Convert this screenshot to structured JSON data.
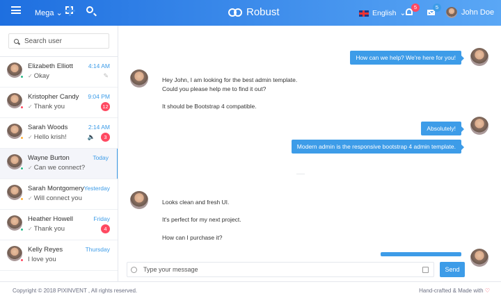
{
  "topbar": {
    "mega_label": "Mega",
    "brand": "Robust",
    "language": "English",
    "notifications_count": "5",
    "messages_count": "5",
    "user_name": "John Doe"
  },
  "sidebar": {
    "search_placeholder": "Search user",
    "contacts": [
      {
        "name": "Elizabeth Elliott",
        "time": "4:14 AM",
        "message": "Okay",
        "ticked": true,
        "badge": "",
        "pinned": true,
        "muted": false,
        "status": "#2bba8a",
        "active": false
      },
      {
        "name": "Kristopher Candy",
        "time": "9:04 PM",
        "message": "Thank you",
        "ticked": true,
        "badge": "12",
        "pinned": false,
        "muted": false,
        "status": "#ff4961",
        "active": false
      },
      {
        "name": "Sarah Woods",
        "time": "2:14 AM",
        "message": "Hello krish!",
        "ticked": true,
        "badge": "3",
        "pinned": false,
        "muted": true,
        "status": "#ffb13c",
        "active": false
      },
      {
        "name": "Wayne Burton",
        "time": "Today",
        "message": "Can we connect?",
        "ticked": true,
        "badge": "",
        "pinned": false,
        "muted": false,
        "status": "#2bba8a",
        "active": true
      },
      {
        "name": "Sarah Montgomery",
        "time": "Yesterday",
        "message": "Will connect you",
        "ticked": true,
        "badge": "",
        "pinned": false,
        "muted": false,
        "status": "#ffb13c",
        "active": false
      },
      {
        "name": "Heather Howell",
        "time": "Friday",
        "message": "Thank you",
        "ticked": true,
        "badge": "4",
        "pinned": false,
        "muted": false,
        "status": "#2bba8a",
        "active": false
      },
      {
        "name": "Kelly Reyes",
        "time": "Thursday",
        "message": "I love you",
        "ticked": false,
        "badge": "",
        "pinned": false,
        "muted": false,
        "status": "#ff4961",
        "active": false
      }
    ]
  },
  "chat": {
    "r1": "How can we help? We're here for you!",
    "l1a": "Hey John, I am looking for the best admin template.",
    "l1b": "Could you please help me to find it out?",
    "l1c": "It should be Bootstrap 4 compatible.",
    "r2a": "Absolutely!",
    "r2b": "Modern admin is the responsive bootstrap 4 admin template.",
    "l2a": "Looks clean and fresh UI.",
    "l2b": "It's perfect for my next project.",
    "l2c": "How can I purchase it?",
    "input_placeholder": "Type your message",
    "send_label": "Send"
  },
  "footer": {
    "copyright": "Copyright © 2018 PIXINVENT , All rights reserved.",
    "credit": "Hand-crafted & Made with",
    "heart": "♡"
  },
  "colors": {
    "accent": "#3d9ce8",
    "danger": "#ff4961",
    "success": "#2bba8a",
    "warning": "#ffb13c"
  }
}
